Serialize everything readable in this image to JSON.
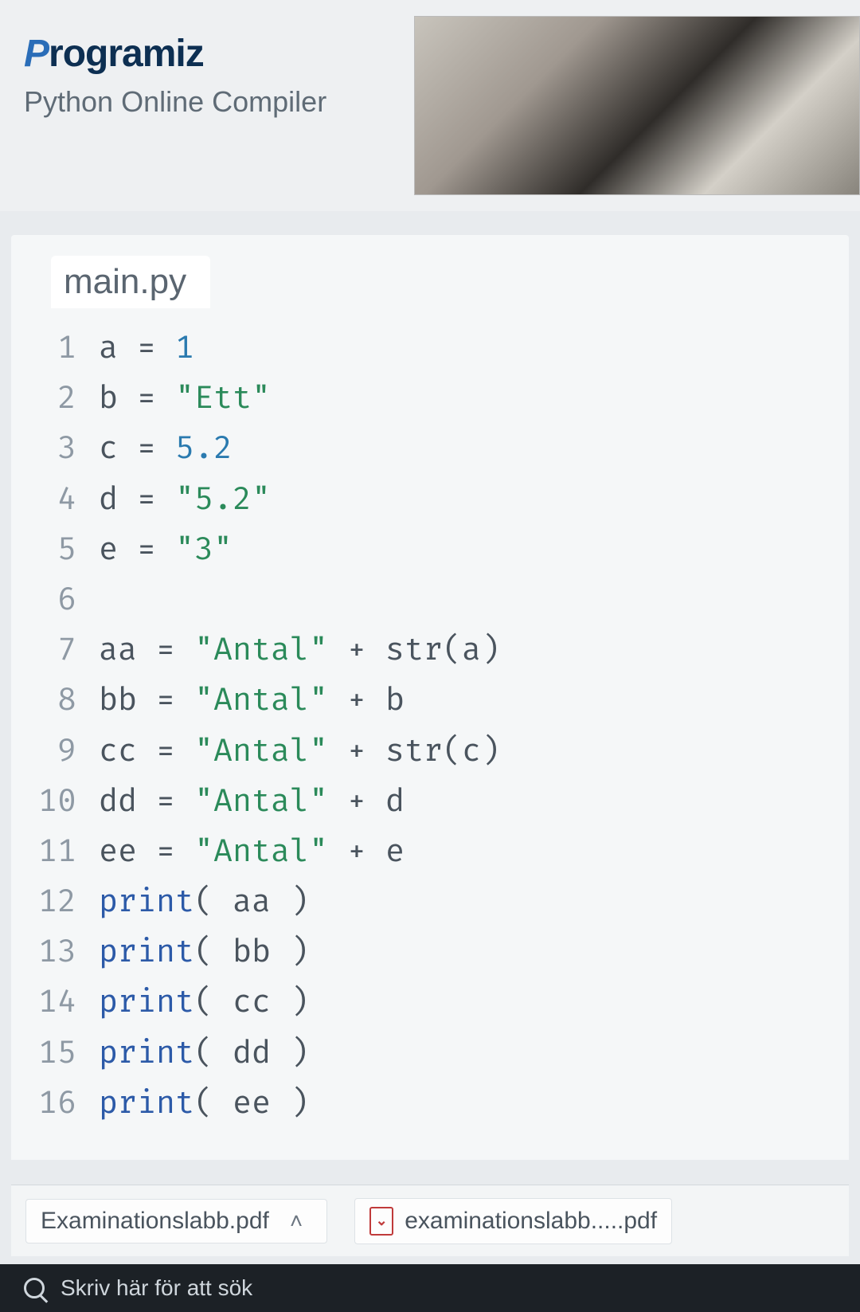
{
  "brand": {
    "first_letter": "P",
    "rest": "rogramiz",
    "subtitle": "Python Online Compiler"
  },
  "editor": {
    "tab_label": "main.py",
    "lines": [
      {
        "n": "1",
        "html": "a = <span class='tk-num'>1</span>"
      },
      {
        "n": "2",
        "html": "b = <span class='tk-str'>\"Ett\"</span>"
      },
      {
        "n": "3",
        "html": "c = <span class='tk-num'>5.2</span>"
      },
      {
        "n": "4",
        "html": "d = <span class='tk-str'>\"5.2\"</span>"
      },
      {
        "n": "5",
        "html": "e = <span class='tk-str'>\"3\"</span>"
      },
      {
        "n": "6",
        "html": ""
      },
      {
        "n": "7",
        "html": "aa = <span class='tk-str'>\"Antal\"</span> + str(a)"
      },
      {
        "n": "8",
        "html": "bb = <span class='tk-str'>\"Antal\"</span> + b"
      },
      {
        "n": "9",
        "html": "cc = <span class='tk-str'>\"Antal\"</span> + str(c)"
      },
      {
        "n": "10",
        "html": "dd = <span class='tk-str'>\"Antal\"</span> + d"
      },
      {
        "n": "11",
        "html": "ee = <span class='tk-str'>\"Antal\"</span> + e"
      },
      {
        "n": "12",
        "html": "<span class='tk-kw'>print</span>( aa )"
      },
      {
        "n": "13",
        "html": "<span class='tk-kw'>print</span>( bb )"
      },
      {
        "n": "14",
        "html": "<span class='tk-kw'>print</span>( cc )"
      },
      {
        "n": "15",
        "html": "<span class='tk-kw'>print</span>( dd )"
      },
      {
        "n": "16",
        "html": "<span class='tk-kw'>print</span>( ee )"
      }
    ]
  },
  "downloads": {
    "item1": "Examinationslabb.pdf",
    "item2": "examinationslabb.....pdf"
  },
  "taskbar": {
    "search_placeholder": "Skriv här för att sök"
  }
}
